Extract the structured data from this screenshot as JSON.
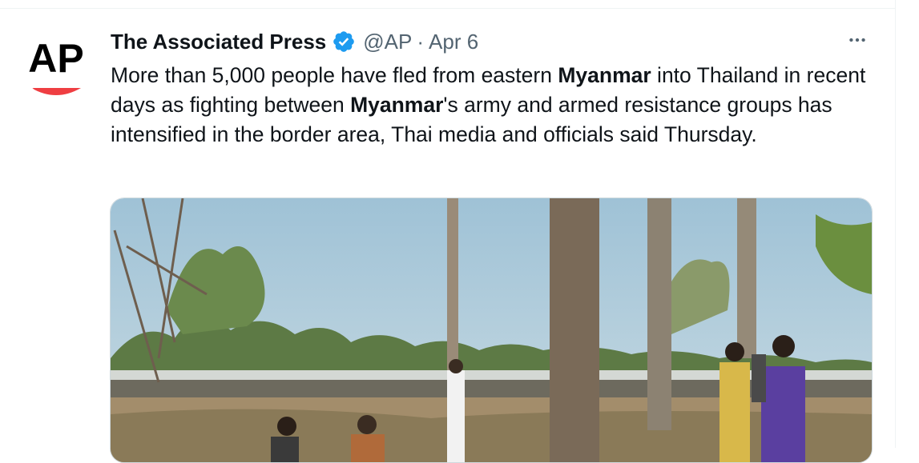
{
  "tweet": {
    "author": {
      "display_name": "The Associated Press",
      "handle": "@AP",
      "verified": true,
      "avatar_text": "AP"
    },
    "separator": "·",
    "date": "Apr 6",
    "text": {
      "seg1": "More than 5,000 people have fled from eastern ",
      "bold1": "Myanmar",
      "seg2": " into Thailand in recent days as fighting between ",
      "bold2": "Myanmar",
      "seg3": "'s army and armed resistance groups has intensified in the border area, Thai media and officials said Thursday."
    },
    "more_icon": "more-horizontal-icon",
    "verified_icon": "verified-badge-icon"
  },
  "colors": {
    "text_primary": "#0f1419",
    "text_secondary": "#536471",
    "verified_blue": "#1d9bf0",
    "ap_red": "#ef3e42",
    "divider": "#eff3f4"
  }
}
